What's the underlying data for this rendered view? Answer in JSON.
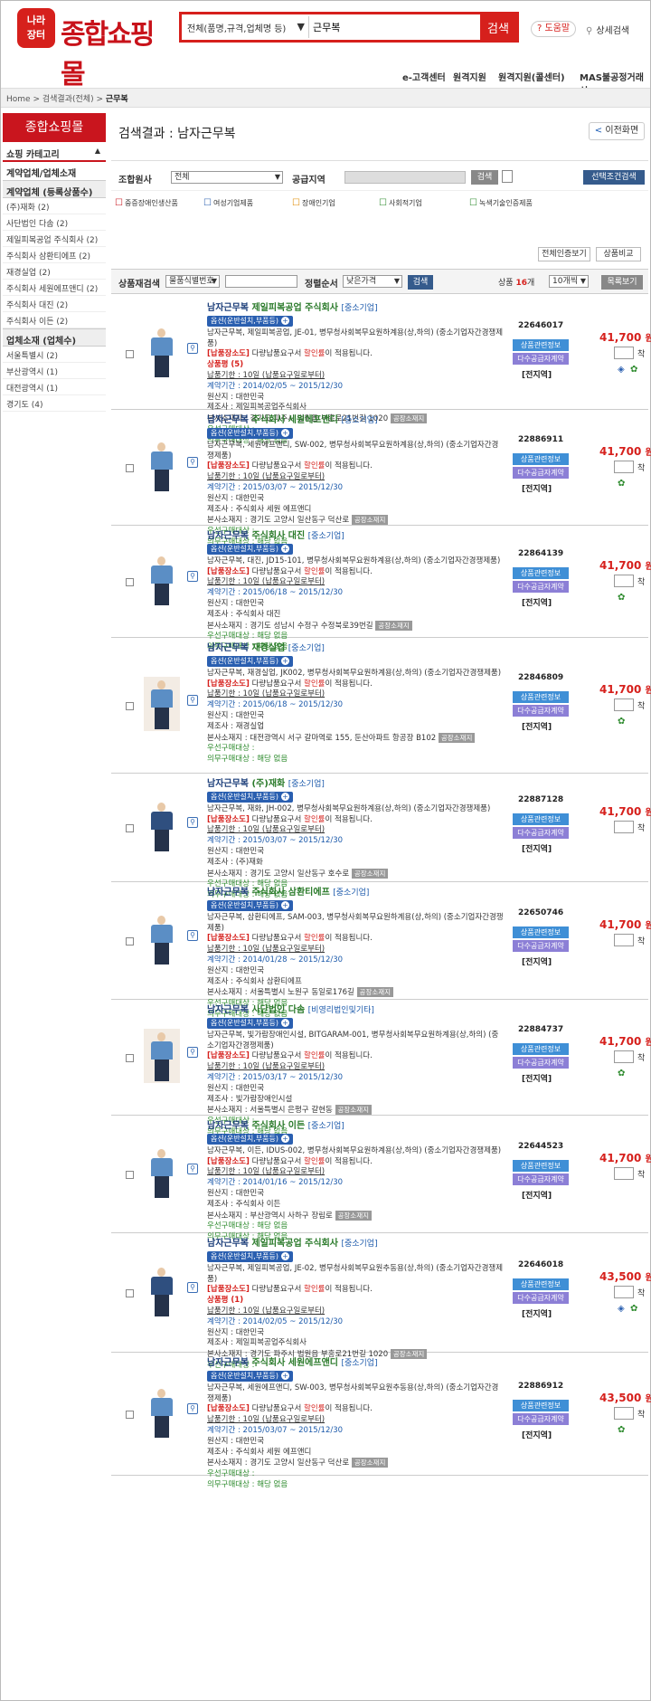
{
  "header": {
    "logo_badge": "나라\n장터",
    "logo_text": "종합쇼핑몰",
    "search_scope": "전체(품명,규격,업체명 등)",
    "search_value": "근무복",
    "search_button": "검색",
    "help": "도움말",
    "advanced": "상세검색"
  },
  "topnav": [
    "e-고객센터",
    "원격지원",
    "원격지원(콜센터)",
    "MAS불공정거래신"
  ],
  "breadcrumb": {
    "home": "Home",
    "sep": ">",
    "level1": "검색결과(전체)",
    "current": "근무복"
  },
  "sidebar": {
    "title": "종합쇼핑몰",
    "category": "쇼핑 카테고리",
    "section": "계약업체/업체소재",
    "sub1": "계약업체 (등록상품수)",
    "vendors": [
      "(주)재화 (2)",
      "사단법인 다솜 (2)",
      "제일피복공업 주식회사 (2)",
      "주식회사 삼환티에프 (2)",
      "재경실업 (2)",
      "주식회사 세원에프앤디 (2)",
      "주식회사 대진 (2)",
      "주식회사 이든 (2)"
    ],
    "sub2": "업체소재 (업체수)",
    "locations": [
      "서울특별시 (2)",
      "부산광역시 (1)",
      "대전광역시 (1)",
      "경기도 (4)"
    ]
  },
  "main": {
    "title": "검색결과 : 남자근무복",
    "back": "이전화면",
    "filter": {
      "group_label": "조합원사",
      "group_value": "전체",
      "region_label": "공급지역",
      "search_btn": "검색",
      "cond_btn": "선택조건검색",
      "types": [
        "중증장애인생산품",
        "여성기업제품",
        "장애인기업",
        "사회적기업",
        "녹색기술인증제품"
      ]
    },
    "toolbar": [
      "전체인증보기",
      "상품비교"
    ],
    "sort": {
      "product_search_label": "상품재검색",
      "product_search_field": "물품식별번호",
      "sort_label": "정렬순서",
      "sort_value": "낮은가격",
      "search_btn": "검색",
      "count_prefix": "상품",
      "count": "16",
      "count_suffix": "개",
      "per_page": "10개씩",
      "list_btn": "목록보기"
    }
  },
  "common": {
    "opt_badge": "옵션(운반설치,부품등)",
    "btn_info": "상품관련정보",
    "btn_supply": "다수공급자계약",
    "region": "[전지역]",
    "price_unit": "원",
    "qty_unit": "착",
    "factory_btn": "공장소재지"
  },
  "products": [
    {
      "name": "남자근무복",
      "company": "제일피복공업 주식회사",
      "size": "[중소기업]",
      "desc": "남자근무복, 제일피복공업, JE-01, 병무청사회복무요원하계용(상,하의) (중소기업자간경쟁제품)",
      "notice_label": "[납품장소도]",
      "notice": "다량납품요구서",
      "discount": "할인률",
      "notice_tail": "이 적용됩니다.",
      "special": "상품평 (5)",
      "delivery": "납품기한 : 10일 (납품요구일로부터)",
      "period": "계약기간 : 2014/02/05 ~ 2015/12/30",
      "origin": "원산지 : 대한민국",
      "maker": "제조사 : 제일피복공업주식회사",
      "address": "본사소재지 : 경기도 파주시 법원읍 부흥로21번길 1020",
      "priority": "우선구매대상 :",
      "mandatory": "의무구매대상 : 해당 없음",
      "id": "22646017",
      "price": "41,700"
    },
    {
      "name": "남자근무복",
      "company": "주식회사 세원에프앤디",
      "size": "[중소기업]",
      "desc": "남자근무복, 세원에프앤디, SW-002, 병무청사회복무요원하계용(상,하의) (중소기업자간경쟁제품)",
      "notice_label": "[납품장소도]",
      "notice": "다량납품요구서",
      "discount": "할인률",
      "notice_tail": "이 적용됩니다.",
      "special": "",
      "delivery": "납품기한 : 10일 (납품요구일로부터)",
      "period": "계약기간 : 2015/03/07 ~ 2015/12/30",
      "origin": "원산지 : 대한민국",
      "maker": "제조사 : 주식회사 세원 에프앤디",
      "address": "본사소재지 : 경기도 고양시 일산동구 덕산로",
      "priority": "우선구매대상 :",
      "mandatory": "의무구매대상 : 해당 없음",
      "id": "22886911",
      "price": "41,700"
    },
    {
      "name": "남자근무복",
      "company": "주식회사 대진",
      "size": "[중소기업]",
      "desc": "남자근무복, 대진, JD15-101, 병무청사회복무요원하계용(상,하의) (중소기업자간경쟁제품)",
      "notice_label": "[납품장소도]",
      "notice": "다량납품요구서",
      "discount": "할인률",
      "notice_tail": "이 적용됩니다.",
      "special": "",
      "delivery": "납품기한 : 10일 (납품요구일로부터)",
      "period": "계약기간 : 2015/06/18 ~ 2015/12/30",
      "origin": "원산지 : 대한민국",
      "maker": "제조사 : 주식회사 대진",
      "address": "본사소재지 : 경기도 성남시 수정구 수정북로39번길",
      "priority": "우선구매대상 : 해당 없음",
      "mandatory": "의무구매대상 : 해당 없음",
      "id": "22864139",
      "price": "41,700"
    },
    {
      "name": "남자근무복",
      "company": "재경실업",
      "size": "[중소기업]",
      "desc": "남자근무복, 재경실업, JK002, 병무청사회복무요원하계용(상,하의) (중소기업자간경쟁제품)",
      "notice_label": "[납품장소도]",
      "notice": "다량납품요구서",
      "discount": "할인률",
      "notice_tail": "이 적용됩니다.",
      "special": "",
      "delivery": "납품기한 : 10일 (납품요구일로부터)",
      "period": "계약기간 : 2015/06/18 ~ 2015/12/30",
      "origin": "원산지 : 대한민국",
      "maker": "제조사 : 재경실업",
      "address": "본사소재지 : 대전광역시 서구 갈마역로 155, 둔산아파트 항공장 B102",
      "priority": "우선구매대상 :",
      "mandatory": "의무구매대상 : 해당 없음",
      "id": "22846809",
      "price": "41,700"
    },
    {
      "name": "남자근무복",
      "company": "(주)재화",
      "size": "[중소기업]",
      "desc": "남자근무복, 재화, JH-002, 병무청사회복무요원하계용(상,하의) (중소기업자간경쟁제품)",
      "notice_label": "[납품장소도]",
      "notice": "다량납품요구서",
      "discount": "할인률",
      "notice_tail": "이 적용됩니다.",
      "special": "",
      "delivery": "납품기한 : 10일 (납품요구일로부터)",
      "period": "계약기간 : 2015/03/07 ~ 2015/12/30",
      "origin": "원산지 : 대한민국",
      "maker": "제조사 : (주)재화",
      "address": "본사소재지 : 경기도 고양시 일산동구 호수로",
      "priority": "우선구매대상 : 해당 없음",
      "mandatory": "의무구매대상 : 해당 없음",
      "id": "22887128",
      "price": "41,700"
    },
    {
      "name": "남자근무복",
      "company": "주식회사 삼환티에프",
      "size": "[중소기업]",
      "desc": "남자근무복, 삼환티에프, SAM-003, 병무청사회복무요원하계용(상,하의) (중소기업자간경쟁제품)",
      "notice_label": "[납품장소도]",
      "notice": "다량납품요구서",
      "discount": "할인률",
      "notice_tail": "이 적용됩니다.",
      "special": "",
      "delivery": "납품기한 : 10일 (납품요구일로부터)",
      "period": "계약기간 : 2014/01/28 ~ 2015/12/30",
      "origin": "원산지 : 대한민국",
      "maker": "제조사 : 주식회사 삼환티에프",
      "address": "본사소재지 : 서울특별시 노원구 동일로176길",
      "priority": "우선구매대상 : 해당 없음",
      "mandatory": "의무구매대상 : 해당 없음",
      "id": "22650746",
      "price": "41,700"
    },
    {
      "name": "남자근무복",
      "company": "사단법인 다솜",
      "size": "[비영리법인및기타]",
      "desc": "남자근무복, 빛가람장애인시설, BITGARAM-001, 병무청사회복무요원하계용(상,하의) (중소기업자간경쟁제품)",
      "notice_label": "[납품장소도]",
      "notice": "다량납품요구서",
      "discount": "할인률",
      "notice_tail": "이 적용됩니다.",
      "special": "",
      "delivery": "납품기한 : 10일 (납품요구일로부터)",
      "period": "계약기간 : 2015/03/17 ~ 2015/12/30",
      "origin": "원산지 : 대한민국",
      "maker": "제조사 : 빛가람장애인시설",
      "address": "본사소재지 : 서울특별시 은평구 갈현동",
      "priority": "우선구매대상 :",
      "mandatory": "의무구매대상 : 해당 없음",
      "id": "22884737",
      "price": "41,700"
    },
    {
      "name": "남자근무복",
      "company": "주식회사 이든",
      "size": "[중소기업]",
      "desc": "남자근무복, 이든, IDUS-002, 병무청사회복무요원하계용(상,하의) (중소기업자간경쟁제품)",
      "notice_label": "[납품장소도]",
      "notice": "다량납품요구서",
      "discount": "할인률",
      "notice_tail": "이 적용됩니다.",
      "special": "",
      "delivery": "납품기한 : 10일 (납품요구일로부터)",
      "period": "계약기간 : 2014/01/16 ~ 2015/12/30",
      "origin": "원산지 : 대한민국",
      "maker": "제조사 : 주식회사 이든",
      "address": "본사소재지 : 부산광역시 사하구 장림로",
      "priority": "우선구매대상 : 해당 없음",
      "mandatory": "의무구매대상 : 해당 없음",
      "id": "22644523",
      "price": "41,700"
    },
    {
      "name": "남자근무복",
      "company": "제일피복공업 주식회사",
      "size": "[중소기업]",
      "desc": "남자근무복, 제일피복공업, JE-02, 병무청사회복무요원추동용(상,하의) (중소기업자간경쟁제품)",
      "notice_label": "[납품장소도]",
      "notice": "다량납품요구서",
      "discount": "할인률",
      "notice_tail": "이 적용됩니다.",
      "special": "상품평 (1)",
      "delivery": "납품기한 : 10일 (납품요구일로부터)",
      "period": "계약기간 : 2014/02/05 ~ 2015/12/30",
      "origin": "원산지 : 대한민국",
      "maker": "제조사 : 제일피복공업주식회사",
      "address": "본사소재지 : 경기도 파주시 법원읍 부흥로21번길 1020",
      "priority": "우선구매대상 :",
      "mandatory": "의무구매대상 : 해당 없음",
      "id": "22646018",
      "price": "43,500"
    },
    {
      "name": "남자근무복",
      "company": "주식회사 세원에프앤디",
      "size": "[중소기업]",
      "desc": "남자근무복, 세원에프앤디, SW-003, 병무청사회복무요원추동용(상,하의) (중소기업자간경쟁제품)",
      "notice_label": "[납품장소도]",
      "notice": "다량납품요구서",
      "discount": "할인률",
      "notice_tail": "이 적용됩니다.",
      "special": "",
      "delivery": "납품기한 : 10일 (납품요구일로부터)",
      "period": "계약기간 : 2015/03/07 ~ 2015/12/30",
      "origin": "원산지 : 대한민국",
      "maker": "제조사 : 주식회사 세원 에프앤디",
      "address": "본사소재지 : 경기도 고양시 일산동구 덕산로",
      "priority": "우선구매대상 :",
      "mandatory": "의무구매대상 : 해당 없음",
      "id": "22886912",
      "price": "43,500"
    }
  ]
}
